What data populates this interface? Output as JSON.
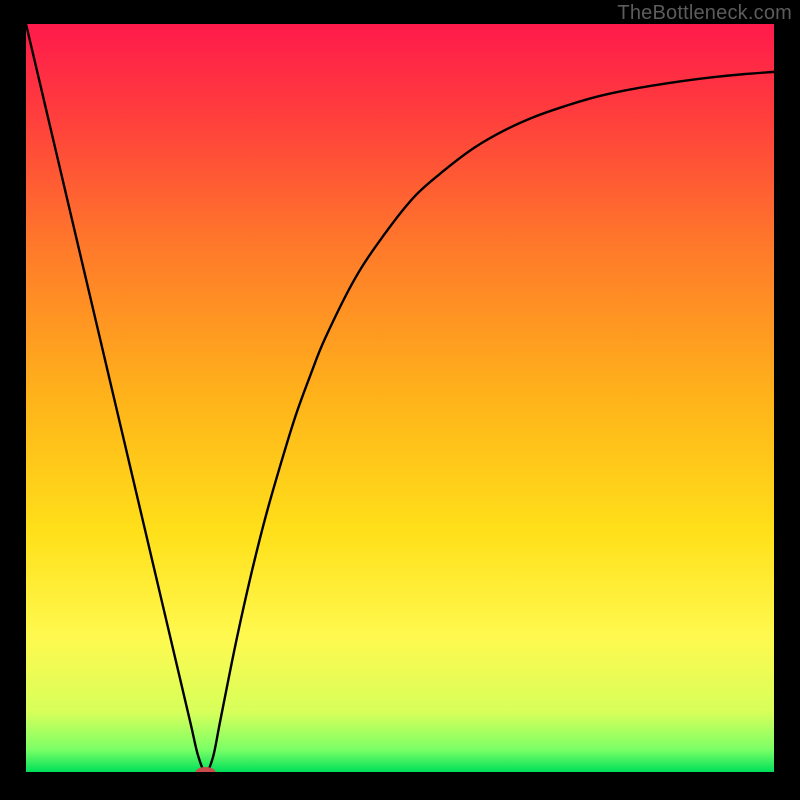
{
  "watermark": "TheBottleneck.com",
  "chart_data": {
    "type": "line",
    "title": "",
    "xlabel": "",
    "ylabel": "",
    "xlim": [
      0,
      100
    ],
    "ylim": [
      0,
      100
    ],
    "grid": false,
    "background_gradient": {
      "stops": [
        {
          "offset": 0.0,
          "color": "#ff1a4b"
        },
        {
          "offset": 0.12,
          "color": "#ff3d3d"
        },
        {
          "offset": 0.3,
          "color": "#ff7a2a"
        },
        {
          "offset": 0.5,
          "color": "#ffb31a"
        },
        {
          "offset": 0.68,
          "color": "#ffe01a"
        },
        {
          "offset": 0.82,
          "color": "#fff94f"
        },
        {
          "offset": 0.92,
          "color": "#d7ff5a"
        },
        {
          "offset": 0.97,
          "color": "#7bff66"
        },
        {
          "offset": 1.0,
          "color": "#00e05a"
        }
      ]
    },
    "series": [
      {
        "name": "bottleneck-curve",
        "color": "#000000",
        "x": [
          0,
          2,
          4,
          6,
          8,
          10,
          12,
          14,
          16,
          18,
          20,
          22,
          23,
          24,
          25,
          26,
          28,
          30,
          32,
          34,
          36,
          38,
          40,
          44,
          48,
          52,
          56,
          60,
          64,
          68,
          72,
          76,
          80,
          84,
          88,
          92,
          96,
          100
        ],
        "y": [
          100,
          91.5,
          83,
          74.5,
          66,
          57.5,
          49,
          40.5,
          32,
          23.5,
          15,
          6.5,
          2.2,
          0,
          2,
          7,
          17,
          26,
          34,
          41,
          47.5,
          53,
          58,
          66,
          72,
          77,
          80.5,
          83.5,
          85.8,
          87.6,
          89,
          90.2,
          91.1,
          91.8,
          92.4,
          92.9,
          93.3,
          93.6
        ]
      }
    ],
    "marker": {
      "name": "optimal-point",
      "x": 24,
      "y": 0,
      "color": "#c94b4b",
      "rx": 10,
      "ry": 5
    }
  }
}
